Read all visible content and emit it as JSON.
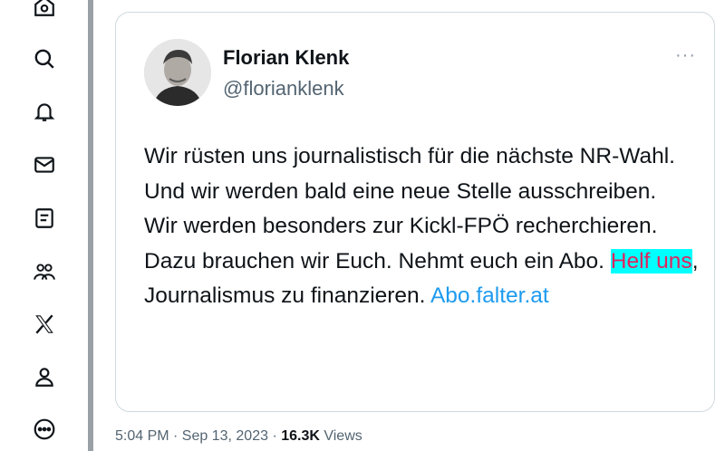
{
  "sidebar": {
    "items": [
      {
        "name": "home-icon"
      },
      {
        "name": "search-icon"
      },
      {
        "name": "notifications-icon"
      },
      {
        "name": "messages-icon"
      },
      {
        "name": "lists-icon"
      },
      {
        "name": "communities-icon"
      },
      {
        "name": "x-logo-icon"
      },
      {
        "name": "profile-icon"
      },
      {
        "name": "more-icon"
      }
    ]
  },
  "tweet": {
    "author_name": "Florian Klenk",
    "author_handle": "@florianklenk",
    "more_label": "···",
    "text_part1": "Wir rüsten uns journalistisch für die nächste NR-Wahl. Und wir werden bald eine neue Stelle ausschreiben.",
    "text_part2": "Wir werden besonders zur Kickl-FPÖ recherchieren. Dazu brauchen wir Euch. Nehmt euch ein Abo. ",
    "highlight": "Helf uns",
    "text_part3": ", Journalismus zu finanzieren. ",
    "link": "Abo.falter.at",
    "highlight_colors": {
      "background": "#00ffff",
      "text": "#e0245e"
    }
  },
  "meta": {
    "timestamp": "5:04 PM · Sep 13, 2023 · ",
    "views_count": "16.3K",
    "views_label": " Views"
  },
  "colors": {
    "accent": "#1d9bf0",
    "divider": "#9aa1a6",
    "muted": "#536471"
  }
}
